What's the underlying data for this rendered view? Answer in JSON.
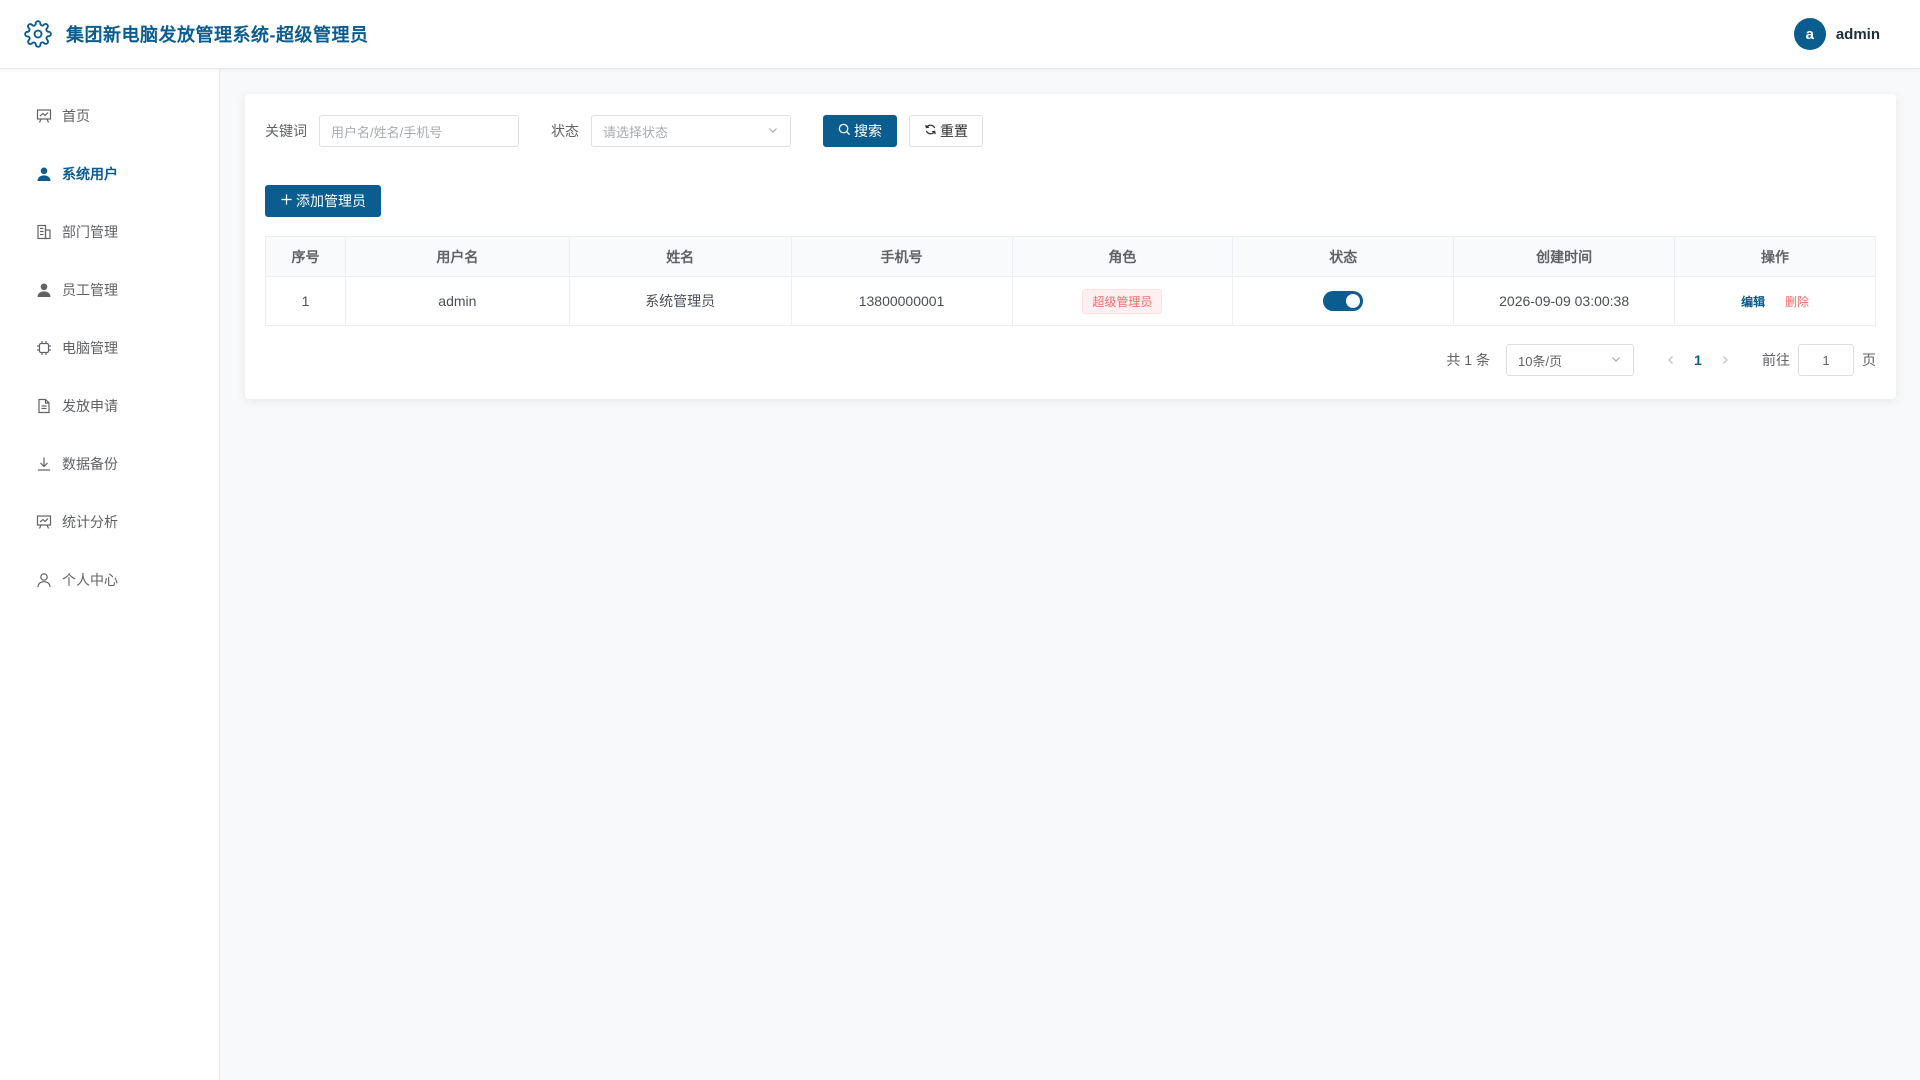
{
  "header": {
    "title": "集团新电脑发放管理系统-超级管理员",
    "avatar_letter": "a",
    "username": "admin"
  },
  "sidebar": {
    "items": [
      {
        "label": "首页",
        "icon": "chart-board-icon",
        "active": false
      },
      {
        "label": "系统用户",
        "icon": "user-filled-icon",
        "active": true
      },
      {
        "label": "部门管理",
        "icon": "building-icon",
        "active": false
      },
      {
        "label": "员工管理",
        "icon": "user-filled-icon",
        "active": false
      },
      {
        "label": "电脑管理",
        "icon": "cpu-chip-icon",
        "active": false
      },
      {
        "label": "发放申请",
        "icon": "document-icon",
        "active": false
      },
      {
        "label": "数据备份",
        "icon": "download-icon",
        "active": false
      },
      {
        "label": "统计分析",
        "icon": "chart-board-icon",
        "active": false
      },
      {
        "label": "个人中心",
        "icon": "user-outline-icon",
        "active": false
      }
    ]
  },
  "search": {
    "keyword_label": "关键词",
    "keyword_placeholder": "用户名/姓名/手机号",
    "status_label": "状态",
    "status_placeholder": "请选择状态",
    "search_label": "搜索",
    "reset_label": "重置"
  },
  "toolbar": {
    "add_label": "添加管理员"
  },
  "table": {
    "columns": [
      "序号",
      "用户名",
      "姓名",
      "手机号",
      "角色",
      "状态",
      "创建时间",
      "操作"
    ],
    "rows": [
      {
        "index": "1",
        "username": "admin",
        "name": "系统管理员",
        "phone": "13800000001",
        "role": "超级管理员",
        "enabled": true,
        "created": "2026-09-09 03:00:38",
        "edit": "编辑",
        "delete": "删除"
      }
    ]
  },
  "pagination": {
    "total": "共 1 条",
    "page_size": "10条/页",
    "current_page": "1",
    "goto_label": "前往",
    "goto_value": "1",
    "page_suffix": "页"
  },
  "colors": {
    "primary": "#0b5c8f",
    "danger": "#f56c6c",
    "background": "#f8f9fb"
  }
}
